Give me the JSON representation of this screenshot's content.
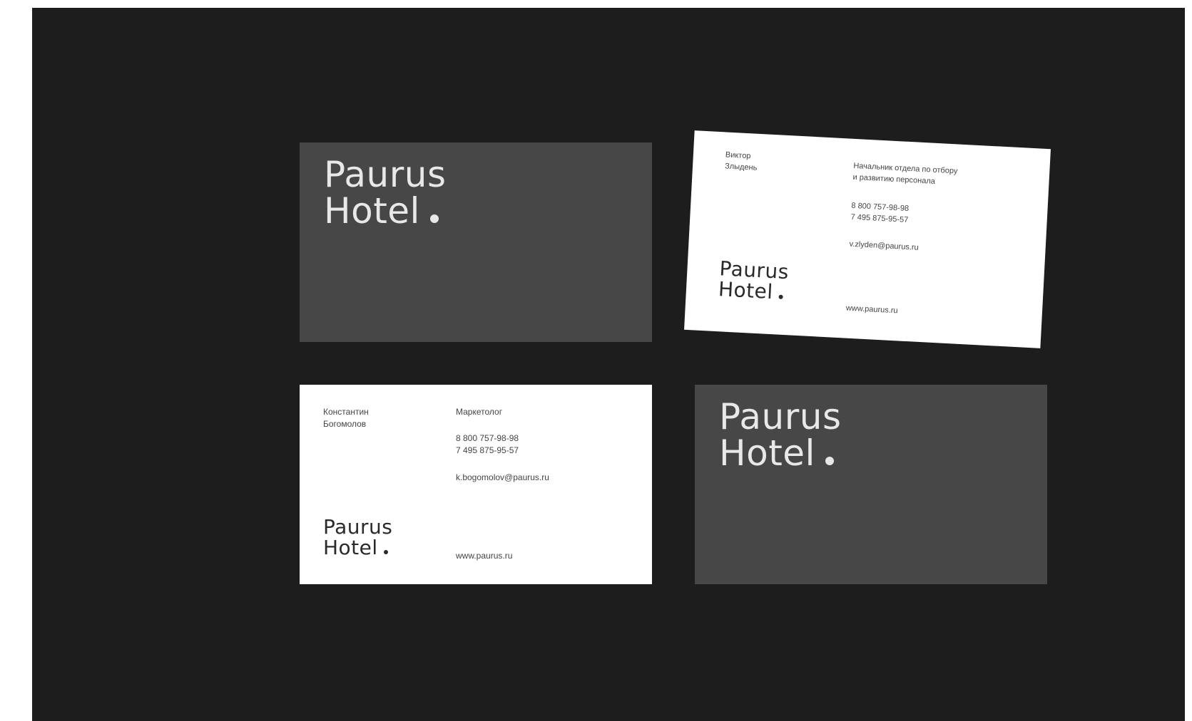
{
  "logo": {
    "line1": "Paurus",
    "line2": "Hotel"
  },
  "card_tilted": {
    "name_line1": "Виктор",
    "name_line2": "Злыдень",
    "position_line1": "Начальник отдела по отбору",
    "position_line2": "и развитию персонала",
    "phone1": "8 800 757-98-98",
    "phone2": "7 495 875-95-57",
    "email": "v.zlyden@paurus.ru",
    "website": "www.paurus.ru"
  },
  "card_bottom_left": {
    "name_line1": "Константин",
    "name_line2": "Богомолов",
    "position": "Маркетолог",
    "phone1": "8 800 757-98-98",
    "phone2": "7 495 875-95-57",
    "email": "k.bogomolov@paurus.ru",
    "website": "www.paurus.ru"
  },
  "colors": {
    "background": "#1d1d1d",
    "card_dark": "#474747",
    "card_light": "#ffffff"
  }
}
